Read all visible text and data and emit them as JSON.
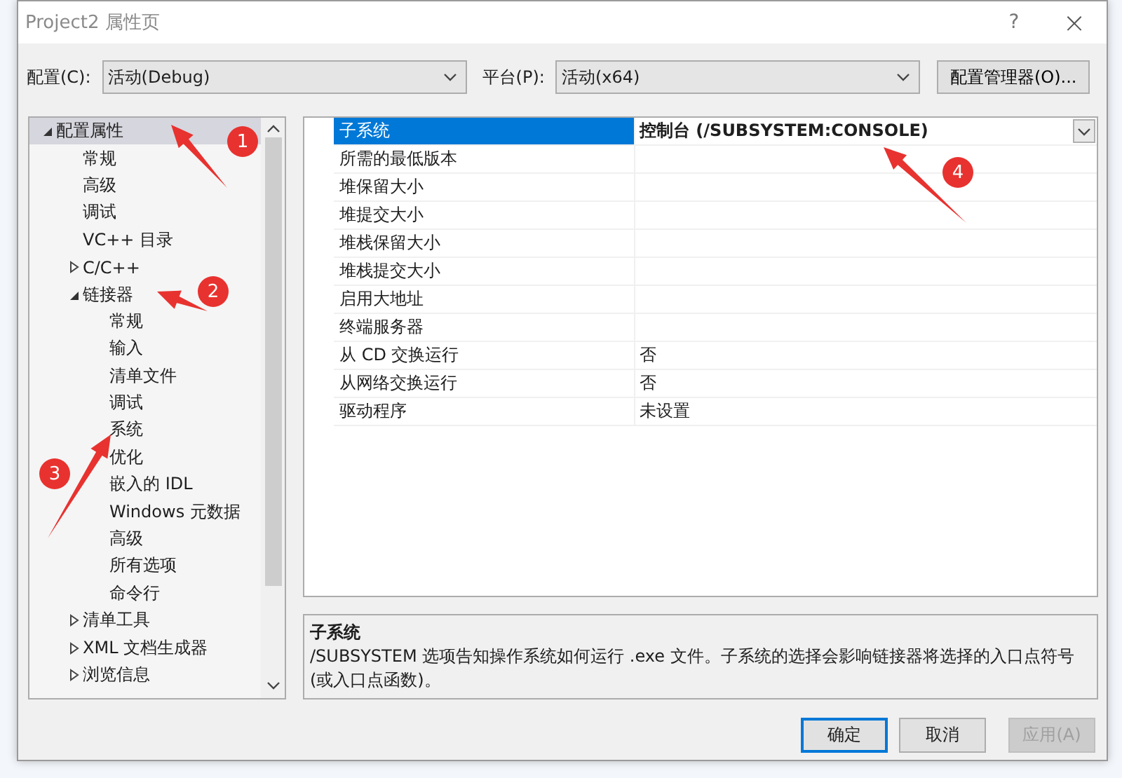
{
  "window": {
    "title": "Project2 属性页",
    "help_button": "?",
    "close_button": "×"
  },
  "config_bar": {
    "configuration_label": "配置(C):",
    "configuration_value": "活动(Debug)",
    "platform_label": "平台(P):",
    "platform_value": "活动(x64)",
    "manager_button": "配置管理器(O)..."
  },
  "tree": [
    {
      "label": "配置属性",
      "selected": true,
      "expanded": true,
      "children": [
        {
          "label": "常规",
          "selected": false
        },
        {
          "label": "高级",
          "selected": false
        },
        {
          "label": "调试",
          "selected": false
        },
        {
          "label": "VC++ 目录",
          "selected": false
        },
        {
          "label": "C/C++",
          "selected": false,
          "expanded": false
        },
        {
          "label": "链接器",
          "selected": false,
          "expanded": true,
          "children": [
            {
              "label": "常规",
              "selected": false
            },
            {
              "label": "输入",
              "selected": false
            },
            {
              "label": "清单文件",
              "selected": false
            },
            {
              "label": "调试",
              "selected": false
            },
            {
              "label": "系统",
              "selected": false
            },
            {
              "label": "优化",
              "selected": false
            },
            {
              "label": "嵌入的 IDL",
              "selected": false
            },
            {
              "label": "Windows 元数据",
              "selected": false
            },
            {
              "label": "高级",
              "selected": false
            },
            {
              "label": "所有选项",
              "selected": false
            },
            {
              "label": "命令行",
              "selected": false
            }
          ]
        },
        {
          "label": "清单工具",
          "selected": false,
          "expanded": false
        },
        {
          "label": "XML 文档生成器",
          "selected": false,
          "expanded": false
        },
        {
          "label": "浏览信息",
          "selected": false,
          "expanded": false
        }
      ]
    }
  ],
  "properties": [
    {
      "name": "子系统",
      "value": "控制台 (/SUBSYSTEM:CONSOLE)",
      "selected": true
    },
    {
      "name": "所需的最低版本",
      "selected": false
    },
    {
      "name": "堆保留大小",
      "selected": false
    },
    {
      "name": "堆提交大小",
      "selected": false
    },
    {
      "name": "堆栈保留大小",
      "selected": false
    },
    {
      "name": "堆栈提交大小",
      "selected": false
    },
    {
      "name": "启用大地址",
      "selected": false
    },
    {
      "name": "终端服务器",
      "selected": false
    },
    {
      "name": "从 CD 交换运行",
      "value": "否",
      "selected": false
    },
    {
      "name": "从网络交换运行",
      "value": "否",
      "selected": false
    },
    {
      "name": "驱动程序",
      "value": "未设置",
      "selected": false
    }
  ],
  "description": {
    "title": "子系统",
    "text": "/SUBSYSTEM 选项告知操作系统如何运行 .exe 文件。子系统的选择会影响链接器将选择的入口点符号(或入口点函数)。"
  },
  "buttons": [
    {
      "label": "确定",
      "kind": "default",
      "disabled": false
    },
    {
      "label": "取消",
      "kind": "normal",
      "disabled": false
    },
    {
      "label": "应用(A)",
      "kind": "normal",
      "disabled": true
    }
  ],
  "annotations": [
    {
      "label": "1"
    },
    {
      "label": "2"
    },
    {
      "label": "3"
    },
    {
      "label": "4"
    }
  ]
}
